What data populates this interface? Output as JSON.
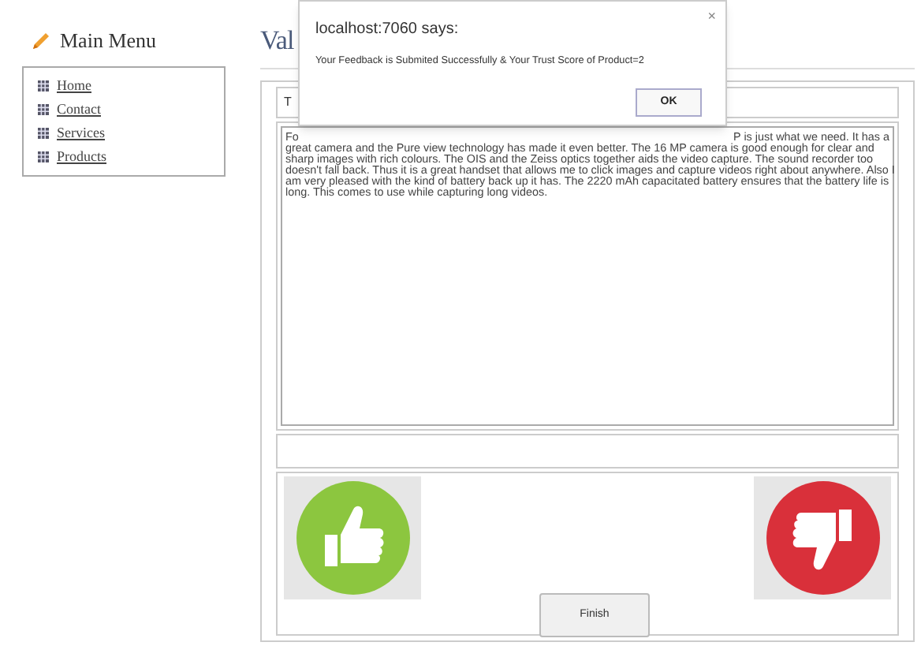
{
  "sidebar": {
    "title": "Main Menu",
    "items": [
      {
        "label": "Home"
      },
      {
        "label": "Contact"
      },
      {
        "label": "Services"
      },
      {
        "label": "Products"
      }
    ]
  },
  "page_title": "Val",
  "table": {
    "header": "T",
    "review": {
      "first_line_left": "Fo",
      "first_line_right": "P is just what we need. It has a",
      "lines": [
        "great camera and the Pure view technology has made it even better. The 16 MP camera is good enough for clear and",
        "sharp images with rich colours. The OIS and the Zeiss optics together aids the video capture. The sound recorder too",
        "doesn't fall back. Thus it is a great handset that allows me to click images and capture videos right about anywhere. Also I",
        "am very pleased with the kind of battery back up it has. The 2220 mAh capacitated battery ensures that the battery life is",
        "long. This comes to use while capturing long videos."
      ]
    },
    "finish_button": "Finish"
  },
  "dialog": {
    "title": "localhost:7060 says:",
    "message": "Your Feedback is Submited Successfully & Your Trust Score of Product=2",
    "close": "×",
    "ok_button": "OK"
  }
}
